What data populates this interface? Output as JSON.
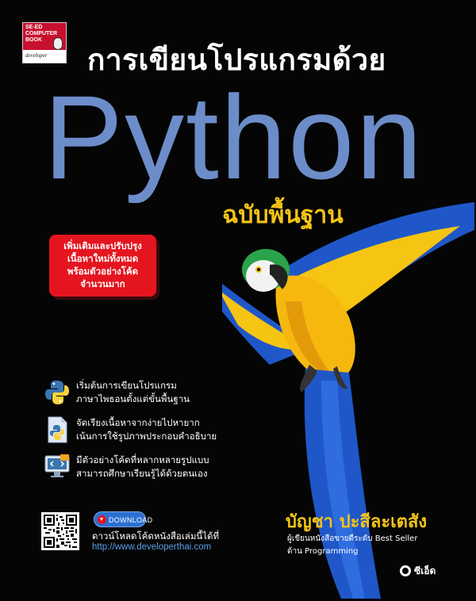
{
  "badge": {
    "line1": "SE-ED",
    "line2": "COMPUTER",
    "line3": "BOOK",
    "line4": "developer"
  },
  "cover": {
    "thai_title": "การเขียนโปรแกรมด้วย",
    "main_title": "Python",
    "subtitle": "ฉบับพื้นฐาน"
  },
  "promo": {
    "lines": [
      "เพิ่มเติมและปรับปรุง",
      "เนื้อหาใหม่ทั้งหมด",
      "พร้อมตัวอย่างโค้ด",
      "จำนวนมาก"
    ]
  },
  "features": [
    {
      "icon": "python-logo-icon",
      "lines": [
        "เริ่มต้นการเขียนโปรแกรม",
        "ภาษาไพธอนตั้งแต่ขั้นพื้นฐาน"
      ]
    },
    {
      "icon": "python-file-icon",
      "lines": [
        "จัดเรียงเนื้อหาจากง่ายไปหายาก",
        "เน้นการใช้รูปภาพประกอบคำอธิบาย"
      ]
    },
    {
      "icon": "monitor-code-icon",
      "lines": [
        "มีตัวอย่างโค้ดที่หลากหลายรูปแบบ",
        "สามารถศึกษาเรียนรู้ได้ด้วยตนเอง"
      ]
    }
  ],
  "download": {
    "button_label": "DOWNLOAD",
    "text": "ดาวน์โหลดโค้ดหนังสือเล่มนี้ได้ที่",
    "url": "http://www.developerthai.com"
  },
  "author": {
    "name": "บัญชา ปะสีละเตสัง",
    "desc_line1": "ผู้เขียนหนังสือขายดีระดับ Best Seller",
    "desc_line2": "ด้าน Programming"
  },
  "publisher": {
    "name": "ซีเอ็ด"
  },
  "colors": {
    "background": "#050505",
    "python_blue": "#6c8dc9",
    "accent_yellow": "#f4c415",
    "promo_red": "#e4151f",
    "link_blue": "#5aa0e6"
  }
}
